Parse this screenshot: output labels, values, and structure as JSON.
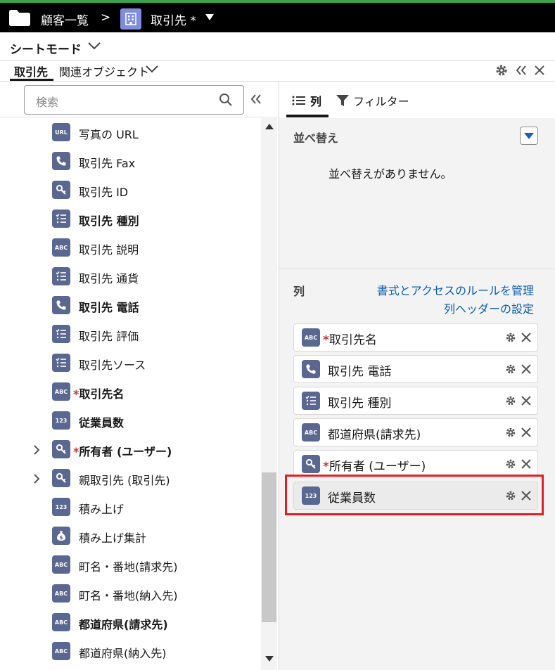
{
  "header": {
    "breadcrumb": "顧客一覧",
    "separator": ">",
    "object_name": "取引先 *"
  },
  "view_mode": {
    "label": "シートモード"
  },
  "tabs": {
    "primary": "取引先",
    "related": "関連オブジェクト"
  },
  "search": {
    "placeholder": "検索"
  },
  "field_list": [
    {
      "label": "写真の URL",
      "icon": "URL",
      "bold": false,
      "expandable": false,
      "required": false
    },
    {
      "label": "取引先 Fax",
      "icon": "phone",
      "bold": false,
      "expandable": false,
      "required": false
    },
    {
      "label": "取引先 ID",
      "icon": "key",
      "bold": false,
      "expandable": false,
      "required": false
    },
    {
      "label": "取引先 種別",
      "icon": "picklist",
      "bold": true,
      "expandable": false,
      "required": false
    },
    {
      "label": "取引先 説明",
      "icon": "ABC",
      "bold": false,
      "expandable": false,
      "required": false
    },
    {
      "label": "取引先 通貨",
      "icon": "picklist",
      "bold": false,
      "expandable": false,
      "required": false
    },
    {
      "label": "取引先 電話",
      "icon": "phone",
      "bold": true,
      "expandable": false,
      "required": false
    },
    {
      "label": "取引先 評価",
      "icon": "picklist",
      "bold": false,
      "expandable": false,
      "required": false
    },
    {
      "label": "取引先ソース",
      "icon": "picklist",
      "bold": false,
      "expandable": false,
      "required": false
    },
    {
      "label": "取引先名",
      "icon": "ABC",
      "bold": true,
      "expandable": false,
      "required": true
    },
    {
      "label": "従業員数",
      "icon": "123",
      "bold": true,
      "expandable": false,
      "required": false
    },
    {
      "label": "所有者 (ユーザー)",
      "icon": "key",
      "bold": true,
      "expandable": true,
      "required": true
    },
    {
      "label": "親取引先 (取引先)",
      "icon": "key",
      "bold": false,
      "expandable": true,
      "required": false
    },
    {
      "label": "積み上げ",
      "icon": "123",
      "bold": false,
      "expandable": false,
      "required": false
    },
    {
      "label": "積み上げ集計",
      "icon": "money",
      "bold": false,
      "expandable": false,
      "required": false
    },
    {
      "label": "町名・番地(請求先)",
      "icon": "ABC",
      "bold": false,
      "expandable": false,
      "required": false
    },
    {
      "label": "町名・番地(納入先)",
      "icon": "ABC",
      "bold": false,
      "expandable": false,
      "required": false
    },
    {
      "label": "都道府県(請求先)",
      "icon": "ABC",
      "bold": true,
      "expandable": false,
      "required": false
    },
    {
      "label": "都道府県(納入先)",
      "icon": "ABC",
      "bold": false,
      "expandable": false,
      "required": false
    }
  ],
  "right_tabs": {
    "columns": "列",
    "filter": "フィルター"
  },
  "sort": {
    "title": "並べ替え",
    "empty_text": "並べ替えがありません。"
  },
  "columns": {
    "title": "列",
    "manage_link": "書式とアクセスのルールを管理",
    "header_link": "列ヘッダーの設定",
    "items": [
      {
        "label": "取引先名",
        "icon": "ABC",
        "required": true,
        "highlighted": false
      },
      {
        "label": "取引先 電話",
        "icon": "phone",
        "required": false,
        "highlighted": false
      },
      {
        "label": "取引先 種別",
        "icon": "picklist",
        "required": false,
        "highlighted": false
      },
      {
        "label": "都道府県(請求先)",
        "icon": "ABC",
        "required": false,
        "highlighted": false
      },
      {
        "label": "所有者 (ユーザー)",
        "icon": "key",
        "required": true,
        "highlighted": false
      },
      {
        "label": "従業員数",
        "icon": "123",
        "required": false,
        "highlighted": true
      }
    ]
  },
  "colors": {
    "header_bg": "#000000",
    "accent_green": "#3aa34a",
    "field_icon_bg": "#5a6790",
    "object_icon_bg": "#7f8de1",
    "link": "#0b5cab",
    "required": "#c23934",
    "highlight_box": "#e01f25"
  }
}
